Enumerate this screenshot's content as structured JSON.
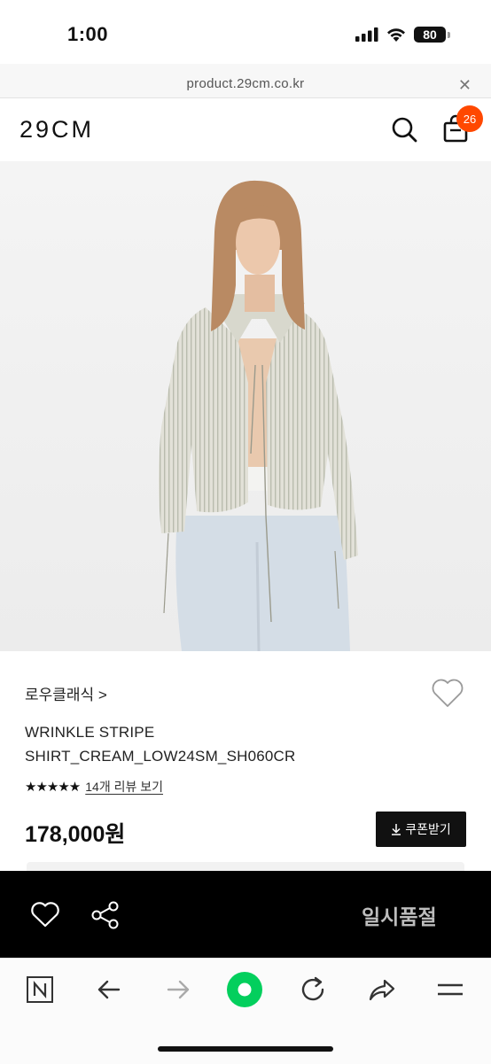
{
  "status_bar": {
    "time": "1:00",
    "battery": "80"
  },
  "url_bar": {
    "url": "product.29cm.co.kr",
    "close_label": "✕"
  },
  "header": {
    "logo": "29CM",
    "cart_count": "26"
  },
  "product": {
    "brand": "로우클래식 >",
    "name_line1": "WRINKLE STRIPE",
    "name_line2": "SHIRT_CREAM_LOW24SM_SH060CR",
    "stars": "★★★★★",
    "review_link": "14개 리뷰 보기",
    "rating": 4.5,
    "price": "178,000원",
    "coupon_label": "쿠폰받기"
  },
  "buy_bar": {
    "status_label": "일시품절"
  },
  "colors": {
    "accent_badge": "#ff4800",
    "buy_bar": "#000000",
    "naver_green": "#03cf5d"
  },
  "icons": [
    "search-icon",
    "cart-icon",
    "heart-icon",
    "share-icon",
    "n-icon",
    "back-arrow-icon",
    "forward-arrow-icon",
    "naver-green-icon",
    "refresh-icon",
    "share-arrow-icon",
    "menu-icon"
  ]
}
